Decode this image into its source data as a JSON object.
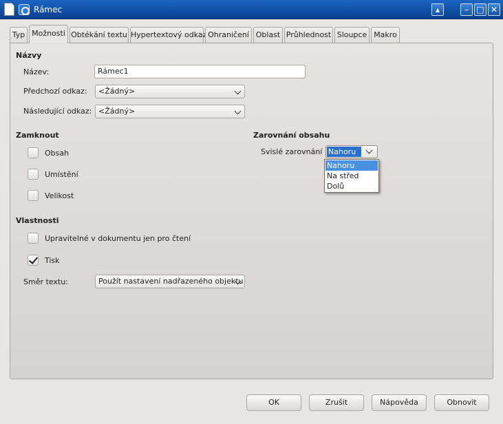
{
  "window": {
    "title": "Rámec"
  },
  "tabs": [
    {
      "label": "Typ"
    },
    {
      "label": "Možnosti"
    },
    {
      "label": "Obtékání textu"
    },
    {
      "label": "Hypertextový odkaz"
    },
    {
      "label": "Ohraničení"
    },
    {
      "label": "Oblast"
    },
    {
      "label": "Průhlednost"
    },
    {
      "label": "Sloupce"
    },
    {
      "label": "Makro"
    }
  ],
  "active_tab": "Možnosti",
  "names": {
    "section_title": "Názvy",
    "name_label": "Název:",
    "name_value": "Rámec1",
    "prev_link_label": "Předchozí odkaz:",
    "prev_link_value": "<Žádný>",
    "next_link_label": "Následující odkaz:",
    "next_link_value": "<Žádný>"
  },
  "lock": {
    "section_title": "Zamknout",
    "items": [
      {
        "label": "Obsah",
        "checked": false
      },
      {
        "label": "Umístění",
        "checked": false
      },
      {
        "label": "Velikost",
        "checked": false
      }
    ]
  },
  "alignment": {
    "section_title": "Zarovnání obsahu",
    "vertical_label": "Svislé zarovnání",
    "vertical_value": "Nahoru",
    "options": [
      "Nahoru",
      "Na střed",
      "Dolů"
    ]
  },
  "properties": {
    "section_title": "Vlastnosti",
    "editable_label": "Upravitelné v dokumentu jen pro čtení",
    "editable_checked": false,
    "print_label": "Tisk",
    "print_checked": true,
    "text_direction_label": "Směr textu:",
    "text_direction_value": "Použít nastavení nadřazeného objektu"
  },
  "buttons": {
    "ok": "OK",
    "cancel": "Zrušit",
    "help": "Nápověda",
    "reset": "Obnovit"
  }
}
